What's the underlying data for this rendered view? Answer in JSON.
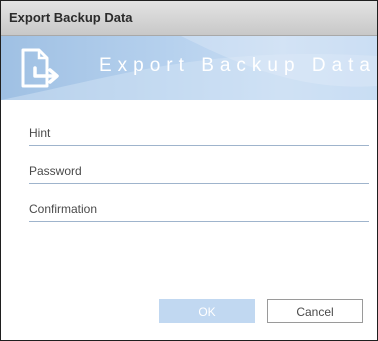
{
  "window": {
    "title": "Export Backup Data"
  },
  "banner": {
    "text": "Export Backup Data",
    "icon": "export-document-icon"
  },
  "form": {
    "fields": [
      {
        "label": "Hint",
        "value": ""
      },
      {
        "label": "Password",
        "value": ""
      },
      {
        "label": "Confirmation",
        "value": ""
      }
    ]
  },
  "buttons": {
    "ok_label": "OK",
    "cancel_label": "Cancel"
  },
  "colors": {
    "banner_blue": "#b6d1ee",
    "field_underline": "#9fb4cc",
    "ok_disabled": "#c1d8f1"
  }
}
